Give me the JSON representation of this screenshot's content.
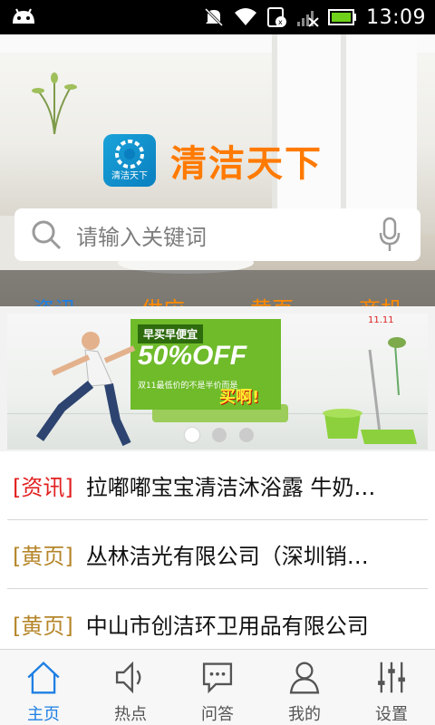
{
  "status_bar": {
    "time": "13:09",
    "icons": [
      "android-icon",
      "mute-icon",
      "wifi-icon",
      "sim-icon",
      "signal-icon",
      "battery-icon"
    ]
  },
  "brand": {
    "logo_text": "清洁天下",
    "name": "清洁天下"
  },
  "search": {
    "placeholder": "请输入关键词",
    "icons": [
      "search-icon",
      "mic-icon"
    ]
  },
  "tabs": [
    {
      "label": "资讯",
      "active": true
    },
    {
      "label": "供应",
      "active": false
    },
    {
      "label": "黄页",
      "active": false
    },
    {
      "label": "商机",
      "active": false
    }
  ],
  "banner": {
    "promo_top": "早买早便宜",
    "promo_big": "50%OFF",
    "promo_small": "双11最低价的不是半价而是",
    "promo_buy": "买啊!",
    "corner_tag": "11.11",
    "active_slide": 1,
    "slide_count": 3
  },
  "news": [
    {
      "tag": "[资讯]",
      "title": "拉嘟嘟宝宝清洁沐浴露 牛奶…",
      "tag_color": "#e21f1f"
    },
    {
      "tag": "[黄页]",
      "title": "丛林洁光有限公司（深圳销…",
      "tag_color": "#b5862a"
    },
    {
      "tag": "[黄页]",
      "title": "中山市创洁环卫用品有限公司",
      "tag_color": "#b5862a"
    }
  ],
  "bottom_nav": [
    {
      "label": "主页",
      "icon": "home-icon",
      "active": true
    },
    {
      "label": "热点",
      "icon": "speaker-icon",
      "active": false
    },
    {
      "label": "问答",
      "icon": "chat-icon",
      "active": false
    },
    {
      "label": "我的",
      "icon": "person-icon",
      "active": false
    },
    {
      "label": "设置",
      "icon": "sliders-icon",
      "active": false
    }
  ],
  "colors": {
    "accent": "#1e7fe3",
    "brand_orange": "#ff7a00",
    "tab_orange": "#ff8a00",
    "tag_red": "#e21f1f",
    "tag_gold": "#b5862a"
  }
}
